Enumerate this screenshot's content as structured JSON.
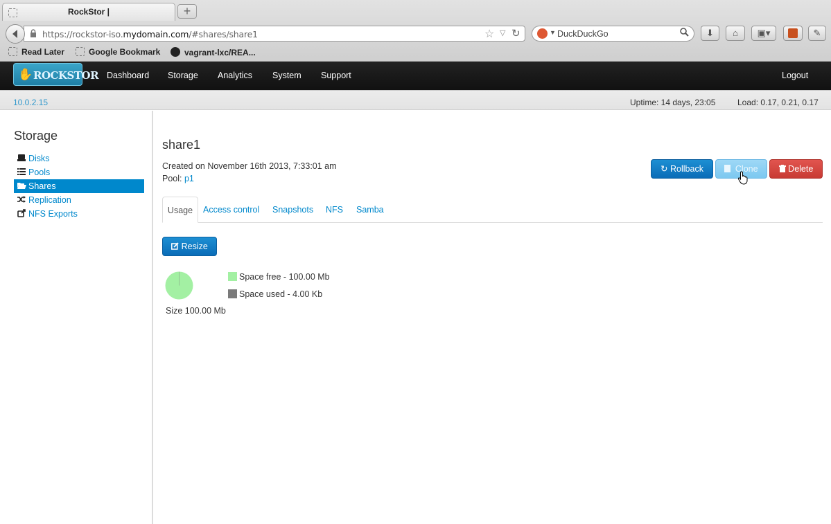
{
  "browser": {
    "tab_title": "RockStor |",
    "new_tab": "+",
    "url_prefix": "https://rockstor-iso.",
    "url_domain": "mydomain.com",
    "url_suffix": "/#shares/share1",
    "search_placeholder": "DuckDuckGo",
    "bookmarks": [
      "Read Later",
      "Google Bookmark",
      "vagrant-lxc/REA..."
    ]
  },
  "app": {
    "logo_text": "ROCKSTOR",
    "nav": [
      "Dashboard",
      "Storage",
      "Analytics",
      "System",
      "Support"
    ],
    "logout": "Logout",
    "ip": "10.0.2.15",
    "uptime": "Uptime: 14 days, 23:05",
    "load": "Load: 0.17, 0.21, 0.17"
  },
  "sidebar": {
    "title": "Storage",
    "items": [
      {
        "label": "Disks",
        "icon": "disk-icon"
      },
      {
        "label": "Pools",
        "icon": "list-icon"
      },
      {
        "label": "Shares",
        "icon": "folder-open-icon"
      },
      {
        "label": "Replication",
        "icon": "shuffle-icon"
      },
      {
        "label": "NFS Exports",
        "icon": "share-icon"
      }
    ],
    "active_index": 2
  },
  "share": {
    "name": "share1",
    "created": "Created on November 16th 2013, 7:33:01 am",
    "pool_label": "Pool:",
    "pool_name": "p1",
    "buttons": {
      "rollback": "Rollback",
      "clone": "Clone",
      "delete": "Delete"
    },
    "tabs": [
      "Usage",
      "Access control",
      "Snapshots",
      "NFS",
      "Samba"
    ],
    "active_tab": "Usage",
    "resize_label": "Resize",
    "size_label": "Size 100.00 Mb",
    "legend": {
      "free": "Space free - 100.00 Mb",
      "used": "Space used - 4.00 Kb"
    },
    "colors": {
      "free": "#a3f0a3",
      "used": "#7a7a7a",
      "accent": "#0088cc"
    }
  }
}
